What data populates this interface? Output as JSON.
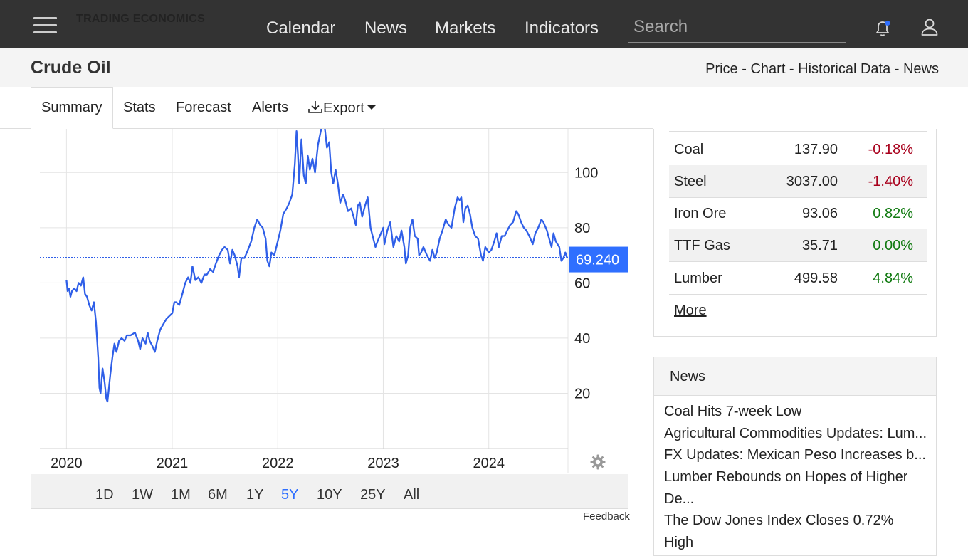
{
  "header": {
    "logo_line1": "TRADING",
    "logo_line2": "ECONOMICS",
    "nav": [
      "Calendar",
      "News",
      "Markets",
      "Indicators"
    ],
    "search_placeholder": "Search",
    "icons": {
      "menu": "hamburger-menu-icon",
      "notifications": "bell-icon",
      "account": "user-icon"
    }
  },
  "page": {
    "title": "Crude Oil",
    "breadcrumb": [
      "Price",
      "Chart",
      "Historical Data",
      "News"
    ],
    "breadcrumb_sep": " - "
  },
  "tabs": [
    "Summary",
    "Stats",
    "Forecast",
    "Alerts",
    "Export"
  ],
  "active_tab": "Summary",
  "chart_data": {
    "type": "line",
    "series": [
      {
        "values": [
          [
            "2020-01-01",
            61
          ],
          [
            "2020-01-05",
            57
          ],
          [
            "2020-01-10",
            58
          ],
          [
            "2020-01-15",
            55
          ],
          [
            "2020-01-20",
            57
          ],
          [
            "2020-01-28",
            58
          ],
          [
            "2020-02-05",
            57
          ],
          [
            "2020-02-12",
            60
          ],
          [
            "2020-02-20",
            59
          ],
          [
            "2020-02-28",
            62
          ],
          [
            "2020-03-05",
            56
          ],
          [
            "2020-03-12",
            55
          ],
          [
            "2020-03-20",
            52
          ],
          [
            "2020-03-28",
            50
          ],
          [
            "2020-04-05",
            53
          ],
          [
            "2020-04-12",
            46
          ],
          [
            "2020-04-20",
            33
          ],
          [
            "2020-04-24",
            22
          ],
          [
            "2020-04-28",
            20
          ],
          [
            "2020-05-05",
            29
          ],
          [
            "2020-05-12",
            24
          ],
          [
            "2020-05-18",
            18
          ],
          [
            "2020-05-22",
            17
          ],
          [
            "2020-06-01",
            27
          ],
          [
            "2020-06-08",
            33
          ],
          [
            "2020-06-15",
            38
          ],
          [
            "2020-06-22",
            35
          ],
          [
            "2020-07-01",
            39
          ],
          [
            "2020-07-10",
            40
          ],
          [
            "2020-07-20",
            39
          ],
          [
            "2020-07-28",
            41
          ],
          [
            "2020-08-10",
            41
          ],
          [
            "2020-08-25",
            42
          ],
          [
            "2020-09-05",
            39
          ],
          [
            "2020-09-12",
            36
          ],
          [
            "2020-09-20",
            40
          ],
          [
            "2020-10-01",
            38
          ],
          [
            "2020-10-08",
            42
          ],
          [
            "2020-10-15",
            39
          ],
          [
            "2020-10-25",
            37
          ],
          [
            "2020-11-02",
            35
          ],
          [
            "2020-11-10",
            39
          ],
          [
            "2020-11-20",
            43
          ],
          [
            "2020-12-01",
            45
          ],
          [
            "2020-12-12",
            47
          ],
          [
            "2020-12-22",
            48
          ],
          [
            "2021-01-01",
            49
          ],
          [
            "2021-01-08",
            53
          ],
          [
            "2021-01-15",
            53
          ],
          [
            "2021-01-25",
            52
          ],
          [
            "2021-02-05",
            56
          ],
          [
            "2021-02-15",
            60
          ],
          [
            "2021-02-25",
            62
          ],
          [
            "2021-03-05",
            60
          ],
          [
            "2021-03-12",
            66
          ],
          [
            "2021-03-22",
            61
          ],
          [
            "2021-04-01",
            62
          ],
          [
            "2021-04-12",
            60
          ],
          [
            "2021-04-22",
            63
          ],
          [
            "2021-05-01",
            63
          ],
          [
            "2021-05-12",
            65
          ],
          [
            "2021-05-22",
            64
          ],
          [
            "2021-06-01",
            67
          ],
          [
            "2021-06-12",
            70
          ],
          [
            "2021-06-22",
            72
          ],
          [
            "2021-07-01",
            73
          ],
          [
            "2021-07-12",
            72
          ],
          [
            "2021-07-20",
            67
          ],
          [
            "2021-07-28",
            72
          ],
          [
            "2021-08-05",
            70
          ],
          [
            "2021-08-15",
            66
          ],
          [
            "2021-08-20",
            62
          ],
          [
            "2021-08-28",
            69
          ],
          [
            "2021-09-08",
            69
          ],
          [
            "2021-09-20",
            72
          ],
          [
            "2021-10-01",
            75
          ],
          [
            "2021-10-12",
            80
          ],
          [
            "2021-10-22",
            83
          ],
          [
            "2021-11-01",
            81
          ],
          [
            "2021-11-10",
            80
          ],
          [
            "2021-11-20",
            76
          ],
          [
            "2021-11-26",
            68
          ],
          [
            "2021-12-03",
            66
          ],
          [
            "2021-12-10",
            71
          ],
          [
            "2021-12-20",
            70
          ],
          [
            "2022-01-01",
            75
          ],
          [
            "2022-01-10",
            79
          ],
          [
            "2022-01-20",
            85
          ],
          [
            "2022-02-01",
            87
          ],
          [
            "2022-02-10",
            89
          ],
          [
            "2022-02-20",
            92
          ],
          [
            "2022-03-01",
            103
          ],
          [
            "2022-03-07",
            115
          ],
          [
            "2022-03-12",
            106
          ],
          [
            "2022-03-16",
            96
          ],
          [
            "2022-03-24",
            112
          ],
          [
            "2022-04-01",
            99
          ],
          [
            "2022-04-08",
            96
          ],
          [
            "2022-04-15",
            106
          ],
          [
            "2022-04-22",
            101
          ],
          [
            "2022-05-01",
            105
          ],
          [
            "2022-05-10",
            100
          ],
          [
            "2022-05-20",
            110
          ],
          [
            "2022-05-28",
            114
          ],
          [
            "2022-06-05",
            118
          ],
          [
            "2022-06-12",
            117
          ],
          [
            "2022-06-20",
            109
          ],
          [
            "2022-06-28",
            111
          ],
          [
            "2022-07-05",
            100
          ],
          [
            "2022-07-12",
            96
          ],
          [
            "2022-07-20",
            101
          ],
          [
            "2022-07-28",
            96
          ],
          [
            "2022-08-05",
            89
          ],
          [
            "2022-08-15",
            92
          ],
          [
            "2022-08-22",
            90
          ],
          [
            "2022-09-01",
            86
          ],
          [
            "2022-09-12",
            87
          ],
          [
            "2022-09-20",
            84
          ],
          [
            "2022-09-28",
            81
          ],
          [
            "2022-10-05",
            88
          ],
          [
            "2022-10-12",
            89
          ],
          [
            "2022-10-20",
            84
          ],
          [
            "2022-10-30",
            88
          ],
          [
            "2022-11-08",
            91
          ],
          [
            "2022-11-18",
            80
          ],
          [
            "2022-11-25",
            77
          ],
          [
            "2022-12-05",
            73
          ],
          [
            "2022-12-12",
            75
          ],
          [
            "2022-12-20",
            77
          ],
          [
            "2023-01-01",
            80
          ],
          [
            "2023-01-05",
            74
          ],
          [
            "2023-01-15",
            79
          ],
          [
            "2023-01-25",
            82
          ],
          [
            "2023-02-05",
            73
          ],
          [
            "2023-02-15",
            77
          ],
          [
            "2023-02-25",
            75
          ],
          [
            "2023-03-05",
            79
          ],
          [
            "2023-03-15",
            73
          ],
          [
            "2023-03-20",
            67
          ],
          [
            "2023-03-28",
            70
          ],
          [
            "2023-04-04",
            80
          ],
          [
            "2023-04-12",
            83
          ],
          [
            "2023-04-20",
            77
          ],
          [
            "2023-04-30",
            76
          ],
          [
            "2023-05-05",
            70
          ],
          [
            "2023-05-12",
            71
          ],
          [
            "2023-05-20",
            73
          ],
          [
            "2023-06-01",
            70
          ],
          [
            "2023-06-12",
            68
          ],
          [
            "2023-06-20",
            72
          ],
          [
            "2023-06-28",
            69
          ],
          [
            "2023-07-05",
            71
          ],
          [
            "2023-07-15",
            76
          ],
          [
            "2023-07-25",
            79
          ],
          [
            "2023-08-05",
            83
          ],
          [
            "2023-08-15",
            81
          ],
          [
            "2023-08-25",
            80
          ],
          [
            "2023-09-05",
            87
          ],
          [
            "2023-09-15",
            91
          ],
          [
            "2023-09-22",
            90
          ],
          [
            "2023-09-28",
            91
          ],
          [
            "2023-10-05",
            82
          ],
          [
            "2023-10-12",
            87
          ],
          [
            "2023-10-20",
            88
          ],
          [
            "2023-10-28",
            85
          ],
          [
            "2023-11-05",
            80
          ],
          [
            "2023-11-15",
            77
          ],
          [
            "2023-11-25",
            76
          ],
          [
            "2023-12-05",
            70
          ],
          [
            "2023-12-12",
            68
          ],
          [
            "2023-12-20",
            73
          ],
          [
            "2024-01-01",
            71
          ],
          [
            "2024-01-10",
            72
          ],
          [
            "2024-01-20",
            75
          ],
          [
            "2024-01-28",
            78
          ],
          [
            "2024-02-05",
            73
          ],
          [
            "2024-02-15",
            77
          ],
          [
            "2024-02-25",
            77
          ],
          [
            "2024-03-05",
            79
          ],
          [
            "2024-03-15",
            81
          ],
          [
            "2024-03-25",
            82
          ],
          [
            "2024-04-05",
            86
          ],
          [
            "2024-04-12",
            85
          ],
          [
            "2024-04-22",
            82
          ],
          [
            "2024-05-01",
            80
          ],
          [
            "2024-05-10",
            79
          ],
          [
            "2024-05-20",
            77
          ],
          [
            "2024-06-01",
            74
          ],
          [
            "2024-06-10",
            78
          ],
          [
            "2024-06-20",
            80
          ],
          [
            "2024-07-01",
            83
          ],
          [
            "2024-07-08",
            82
          ],
          [
            "2024-07-20",
            79
          ],
          [
            "2024-07-28",
            76
          ],
          [
            "2024-08-05",
            73
          ],
          [
            "2024-08-12",
            78
          ],
          [
            "2024-08-20",
            75
          ],
          [
            "2024-09-01",
            73
          ],
          [
            "2024-09-08",
            68
          ],
          [
            "2024-09-15",
            69
          ],
          [
            "2024-09-22",
            71
          ],
          [
            "2024-09-28",
            69
          ]
        ]
      }
    ],
    "x_labels": [
      "2020",
      "2021",
      "2022",
      "2023",
      "2024"
    ],
    "y_ticks": [
      20,
      40,
      60,
      80,
      100
    ],
    "last_value": 69.24,
    "last_label": "69.240",
    "ylim": [
      0,
      115
    ],
    "xlim": [
      "2019-10-01",
      "2024-10-01"
    ],
    "color": "#2f5fe8",
    "grid": true
  },
  "ranges": [
    "1D",
    "1W",
    "1M",
    "6M",
    "1Y",
    "5Y",
    "10Y",
    "25Y",
    "All"
  ],
  "active_range": "5Y",
  "feedback": "Feedback",
  "commodities": [
    {
      "name": "Coal",
      "price": "137.90",
      "change": "-0.18%",
      "dir": "neg"
    },
    {
      "name": "Steel",
      "price": "3037.00",
      "change": "-1.40%",
      "dir": "neg"
    },
    {
      "name": "Iron Ore",
      "price": "93.06",
      "change": "0.82%",
      "dir": "pos"
    },
    {
      "name": "TTF Gas",
      "price": "35.71",
      "change": "0.00%",
      "dir": "pos"
    },
    {
      "name": "Lumber",
      "price": "499.58",
      "change": "4.84%",
      "dir": "pos"
    }
  ],
  "more_label": "More",
  "news": {
    "title": "News",
    "items": [
      "Coal Hits 7-week Low",
      "Agricultural Commodities Updates: Lum...",
      "FX Updates: Mexican Peso Increases b...",
      "Lumber Rebounds on Hopes of Higher",
      "De...",
      "The Dow Jones Index Closes 0.72%",
      "High"
    ]
  }
}
